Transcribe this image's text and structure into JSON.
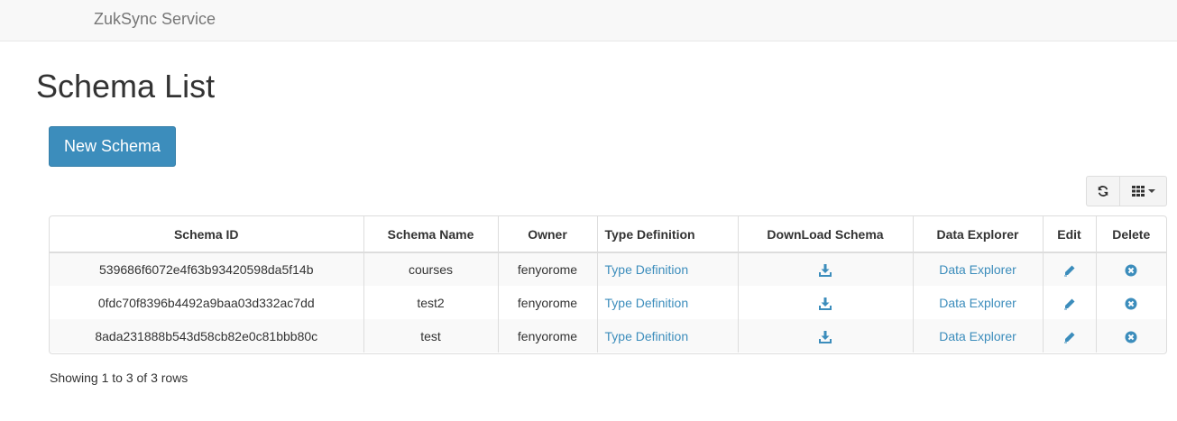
{
  "navbar": {
    "brand": "ZukSync Service"
  },
  "page": {
    "title": "Schema List"
  },
  "actions": {
    "new_schema": "New Schema"
  },
  "icons": {
    "refresh": "refresh-icon",
    "columns": "grid-icon",
    "download": "download-icon",
    "edit": "pencil-icon",
    "delete": "remove-circle-icon"
  },
  "colors": {
    "accent": "#3c8dbc",
    "navbar_bg": "#f8f8f8",
    "stripe": "#f9f9f9"
  },
  "table": {
    "headers": [
      "Schema ID",
      "Schema Name",
      "Owner",
      "Type Definition",
      "DownLoad Schema",
      "Data Explorer",
      "Edit",
      "Delete"
    ],
    "rows": [
      {
        "id": "539686f6072e4f63b93420598da5f14b",
        "name": "courses",
        "owner": "fenyorome",
        "type_definition": "Type Definition",
        "data_explorer": "Data Explorer"
      },
      {
        "id": "0fdc70f8396b4492a9baa03d332ac7dd",
        "name": "test2",
        "owner": "fenyorome",
        "type_definition": "Type Definition",
        "data_explorer": "Data Explorer"
      },
      {
        "id": "8ada231888b543d58cb82e0c81bbb80c",
        "name": "test",
        "owner": "fenyorome",
        "type_definition": "Type Definition",
        "data_explorer": "Data Explorer"
      }
    ]
  },
  "pagination": {
    "summary": "Showing 1 to 3 of 3 rows"
  }
}
